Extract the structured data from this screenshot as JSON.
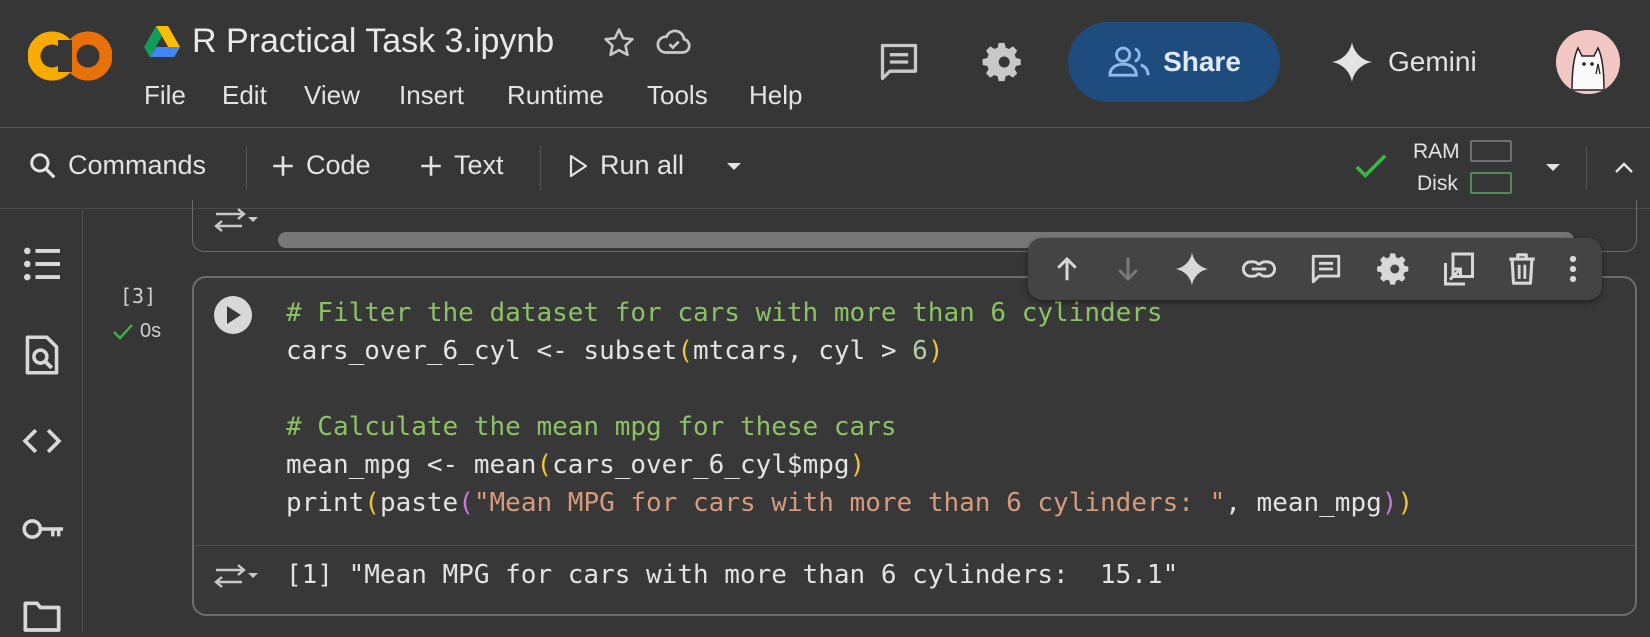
{
  "header": {
    "title": "R Practical Task 3.ipynb",
    "menu": [
      "File",
      "Edit",
      "View",
      "Insert",
      "Runtime",
      "Tools",
      "Help"
    ],
    "share_label": "Share",
    "gemini_label": "Gemini"
  },
  "toolbar": {
    "commands_label": "Commands",
    "code_label": "Code",
    "text_label": "Text",
    "run_all_label": "Run all",
    "ram_label": "RAM",
    "disk_label": "Disk"
  },
  "cell": {
    "execution_count": "[3]",
    "exec_time": "0s",
    "code": {
      "line1_comment": "# Filter the dataset for cars with more than 6 cylinders",
      "line2_a": "cars_over_6_cyl <- subset",
      "line2_paren_open": "(",
      "line2_b": "mtcars, cyl > ",
      "line2_num": "6",
      "line2_paren_close": ")",
      "line4_comment": "# Calculate the mean mpg for these cars",
      "line5_a": "mean_mpg <- mean",
      "line5_paren_open": "(",
      "line5_b": "cars_over_6_cyl$mpg",
      "line5_paren_close": ")",
      "line6_a": "print",
      "line6_p1": "(",
      "line6_b": "paste",
      "line6_p2": "(",
      "line6_str": "\"Mean MPG for cars with more than 6 cylinders: \"",
      "line6_c": ", mean_mpg",
      "line6_p3": ")",
      "line6_p4": ")"
    },
    "output": "[1] \"Mean MPG for cars with more than 6 cylinders:  15.1\""
  },
  "colors": {
    "accent_blue": "#1f4c7e",
    "logo_orange": "#f0a030",
    "comment_green": "#8cc265",
    "string_orange": "#d69a7c",
    "paren_yellow": "#f0c23b"
  }
}
